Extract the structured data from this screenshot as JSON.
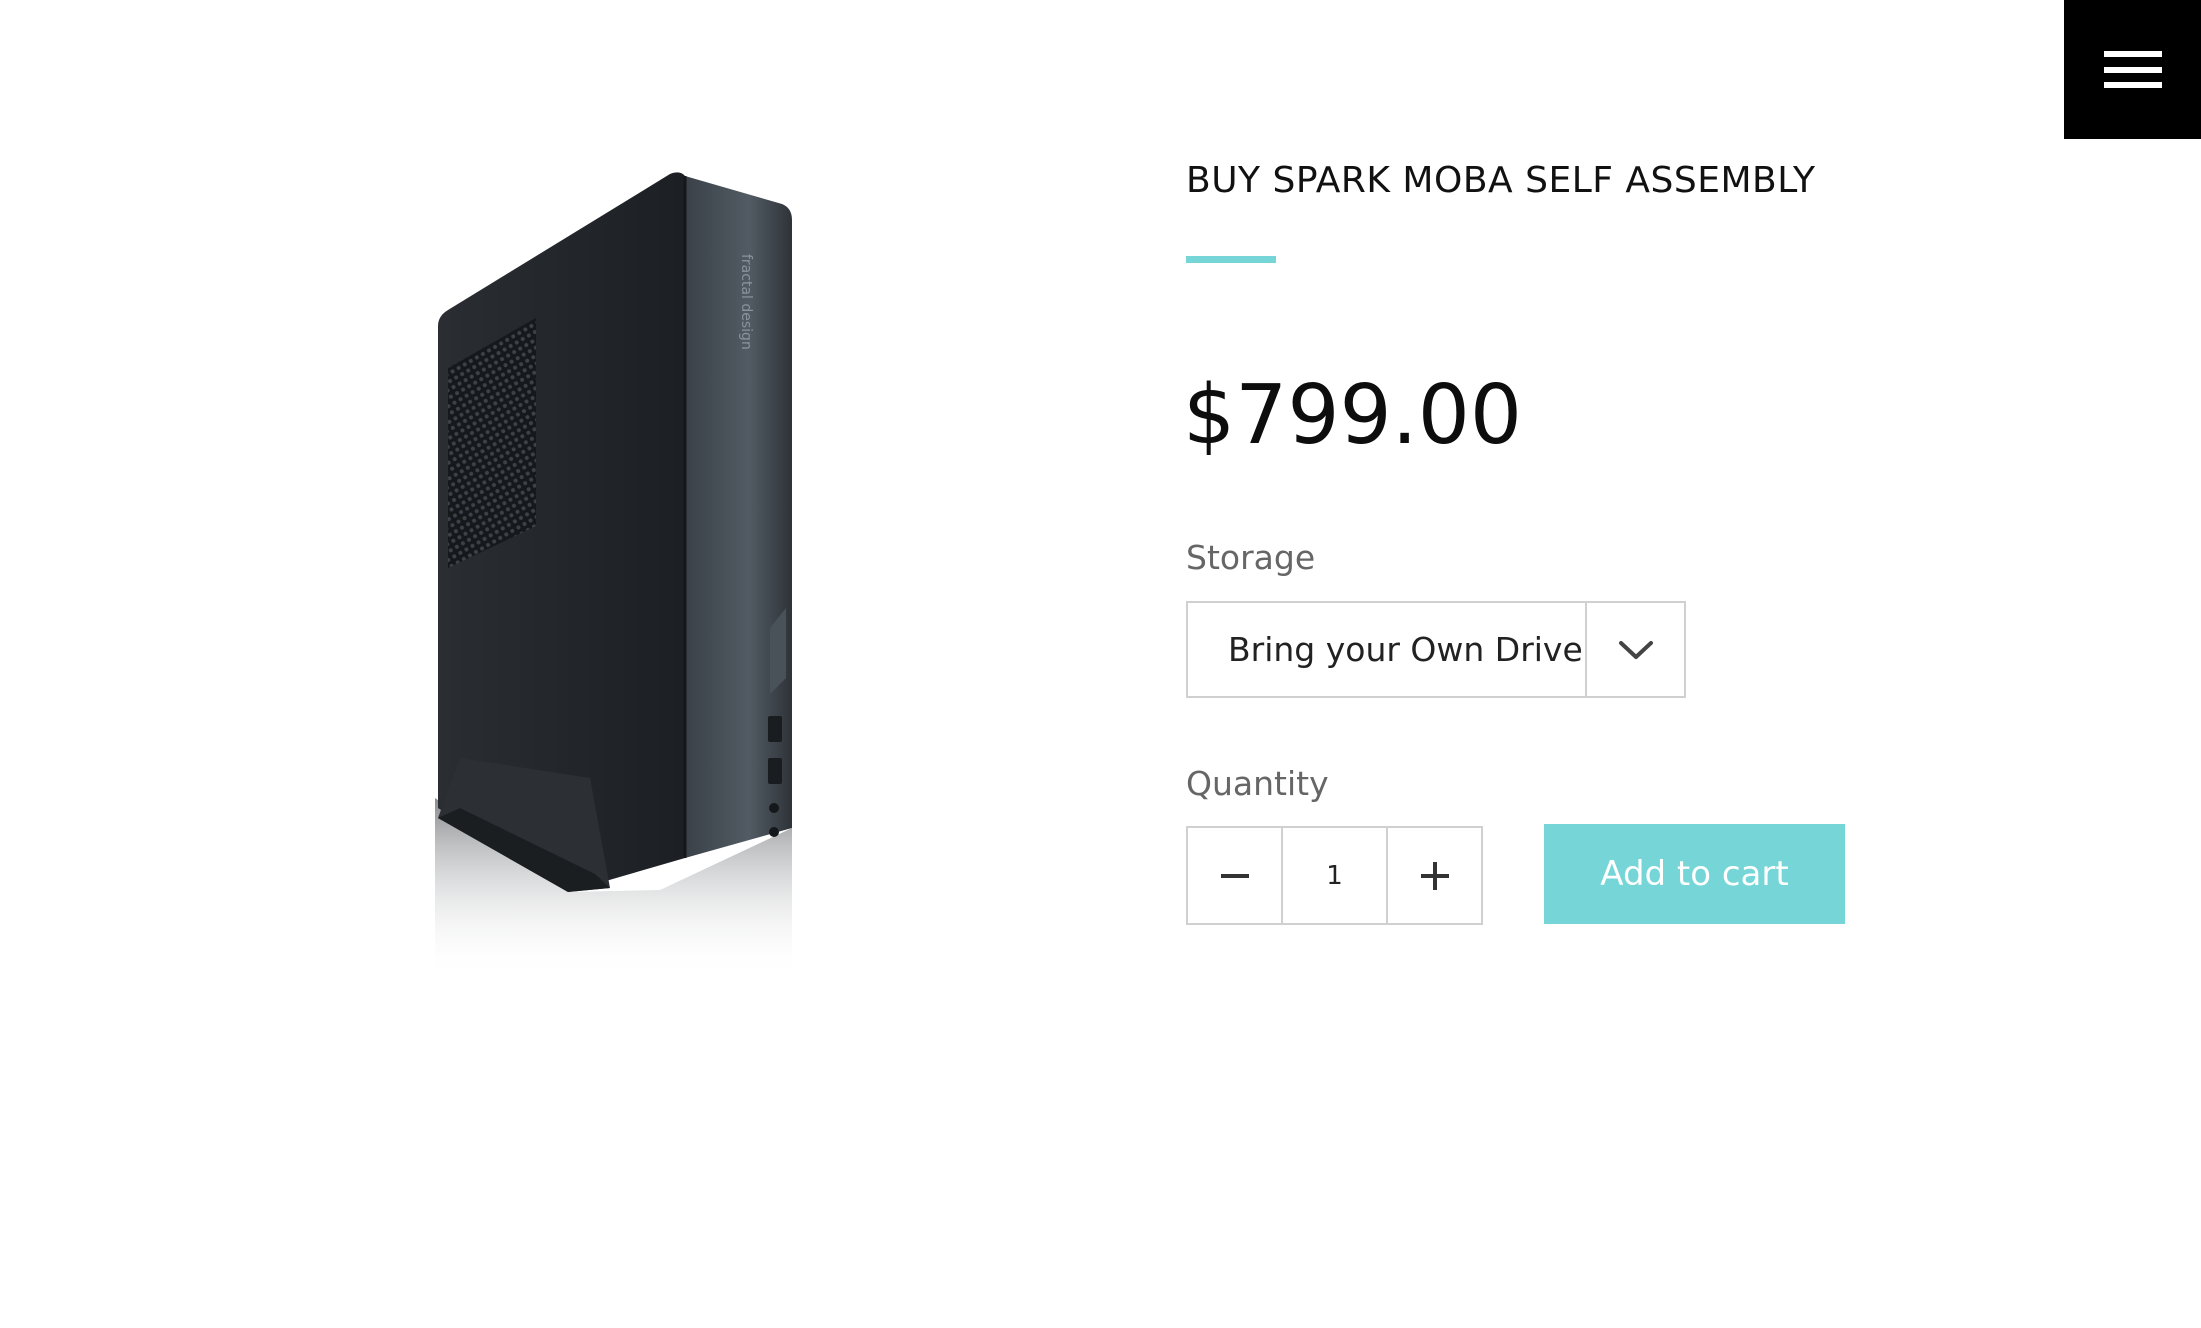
{
  "header": {
    "menu_icon": "hamburger-menu-icon"
  },
  "product": {
    "image_alt": "fractal design",
    "title": "BUY SPARK MOBA SELF ASSEMBLY",
    "price": "$799.00"
  },
  "options": {
    "storage_label": "Storage",
    "storage_selected": "Bring your Own Drive",
    "quantity_label": "Quantity",
    "quantity_value": "1",
    "add_to_cart_label": "Add to cart"
  },
  "colors": {
    "accent": "#76d5d6",
    "menu_bg": "#000000",
    "text": "#111111",
    "label": "#666666",
    "border": "#d0d0d0"
  }
}
